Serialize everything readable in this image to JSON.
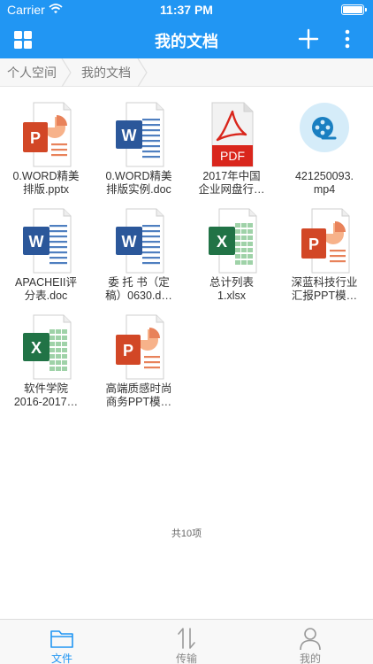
{
  "status_bar": {
    "carrier": "Carrier",
    "time": "11:37 PM"
  },
  "nav": {
    "title": "我的文档"
  },
  "breadcrumb": [
    "个人空间",
    "我的文档"
  ],
  "files": [
    {
      "icon": "ppt",
      "line1": "0.WORD精美",
      "line2": "排版.pptx"
    },
    {
      "icon": "word",
      "line1": "0.WORD精美",
      "line2": "排版实例.doc"
    },
    {
      "icon": "pdf",
      "line1": "2017年中国",
      "line2": "企业网盘行…"
    },
    {
      "icon": "video",
      "line1": "421250093.",
      "line2": "mp4"
    },
    {
      "icon": "word",
      "line1": "APACHEII评",
      "line2": "分表.doc"
    },
    {
      "icon": "word",
      "line1": "委 托 书（定",
      "line2": "稿）0630.d…"
    },
    {
      "icon": "excel",
      "line1": "总计列表",
      "line2": "1.xlsx"
    },
    {
      "icon": "ppt",
      "line1": "深蓝科技行业",
      "line2": "汇报PPT模…"
    },
    {
      "icon": "excel",
      "line1": "软件学院",
      "line2": "2016-2017…"
    },
    {
      "icon": "ppt",
      "line1": "高端质感时尚",
      "line2": "商务PPT模…"
    }
  ],
  "count_text": "共10项",
  "tabs": [
    {
      "label": "文件",
      "icon": "folder-icon",
      "active": true
    },
    {
      "label": "传输",
      "icon": "transfer-icon",
      "active": false
    },
    {
      "label": "我的",
      "icon": "person-icon",
      "active": false
    }
  ],
  "colors": {
    "accent": "#2196f3",
    "ppt": "#d24726",
    "word": "#2b579a",
    "excel": "#217346",
    "pdf": "#d9261c"
  }
}
